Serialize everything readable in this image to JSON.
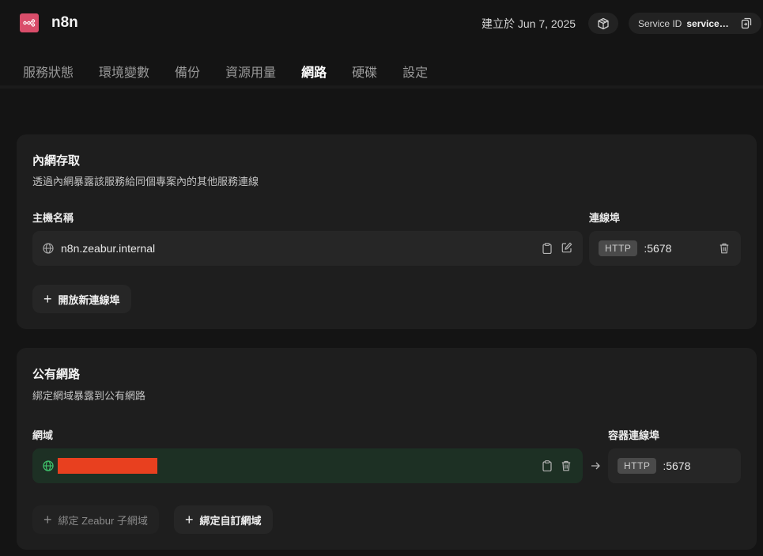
{
  "header": {
    "app_name": "n8n",
    "created": "建立於 Jun 7, 2025",
    "service_id_label": "Service ID",
    "service_id_value": "service-…"
  },
  "tabs": [
    {
      "label": "服務狀態",
      "active": false
    },
    {
      "label": "環境變數",
      "active": false
    },
    {
      "label": "備份",
      "active": false
    },
    {
      "label": "資源用量",
      "active": false
    },
    {
      "label": "網路",
      "active": true
    },
    {
      "label": "硬碟",
      "active": false
    },
    {
      "label": "設定",
      "active": false
    }
  ],
  "private_network": {
    "title": "內網存取",
    "description": "透過內網暴露該服務給同個專案內的其他服務連線",
    "hostname_label": "主機名稱",
    "hostname": "n8n.zeabur.internal",
    "port_label": "連線埠",
    "protocol": "HTTP",
    "port": ":5678",
    "add_port_button": "開放新連線埠"
  },
  "public_network": {
    "title": "公有網路",
    "description": "綁定網域暴露到公有網路",
    "domain_label": "網域",
    "domain": "",
    "container_port_label": "容器連線埠",
    "protocol": "HTTP",
    "port": ":5678",
    "bind_zeabur_button": "綁定 Zeabur 子網域",
    "bind_custom_button": "綁定自訂網域"
  },
  "colors": {
    "background": "#141414",
    "card": "#1e1e1e",
    "logo": "#d94d6a",
    "domain_row": "#1d3024",
    "redaction": "#e8401f",
    "domain_globe": "#3fbf6a"
  },
  "icons": [
    "globe-icon",
    "clipboard-icon",
    "edit-icon",
    "trash-icon",
    "plus-icon",
    "arrow-right-icon",
    "cube-icon",
    "copy-icon"
  ]
}
